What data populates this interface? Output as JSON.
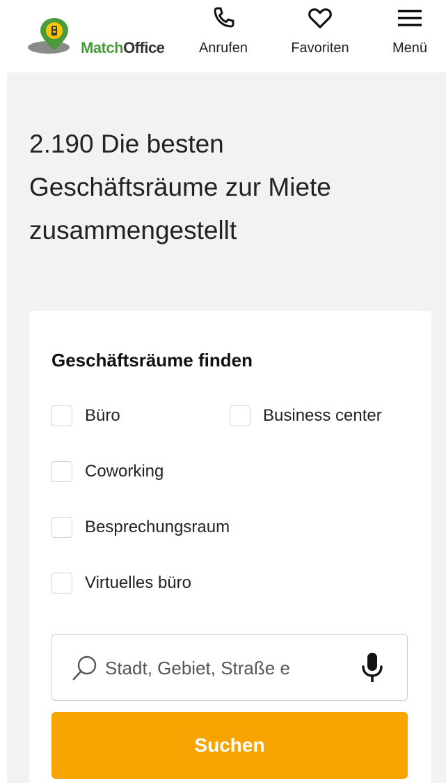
{
  "brand": {
    "name_part1": "Match",
    "name_part2": "Office",
    "green": "#4a9b3b"
  },
  "nav": {
    "call_label": "Anrufen",
    "favorites_label": "Favoriten",
    "menu_label": "Menü",
    "icons": [
      "phone-icon",
      "heart-icon",
      "hamburger-menu-icon"
    ]
  },
  "hero": {
    "headline_line1": "2.190 Die besten",
    "headline_line2": "Geschäftsräume zur Miete",
    "headline_line3": "zusammengestellt"
  },
  "search_card": {
    "title": "Geschäftsräume finden",
    "options": [
      {
        "label": "Büro",
        "checked": false
      },
      {
        "label": "Business center",
        "checked": false
      },
      {
        "label": "Coworking",
        "checked": false
      },
      {
        "label": "Besprechungsraum",
        "checked": false
      },
      {
        "label": "Virtuelles büro",
        "checked": false
      }
    ],
    "search_placeholder": "Stadt, Gebiet, Straße e",
    "search_value": "",
    "button_label": "Suchen",
    "button_color": "#f7a400"
  }
}
